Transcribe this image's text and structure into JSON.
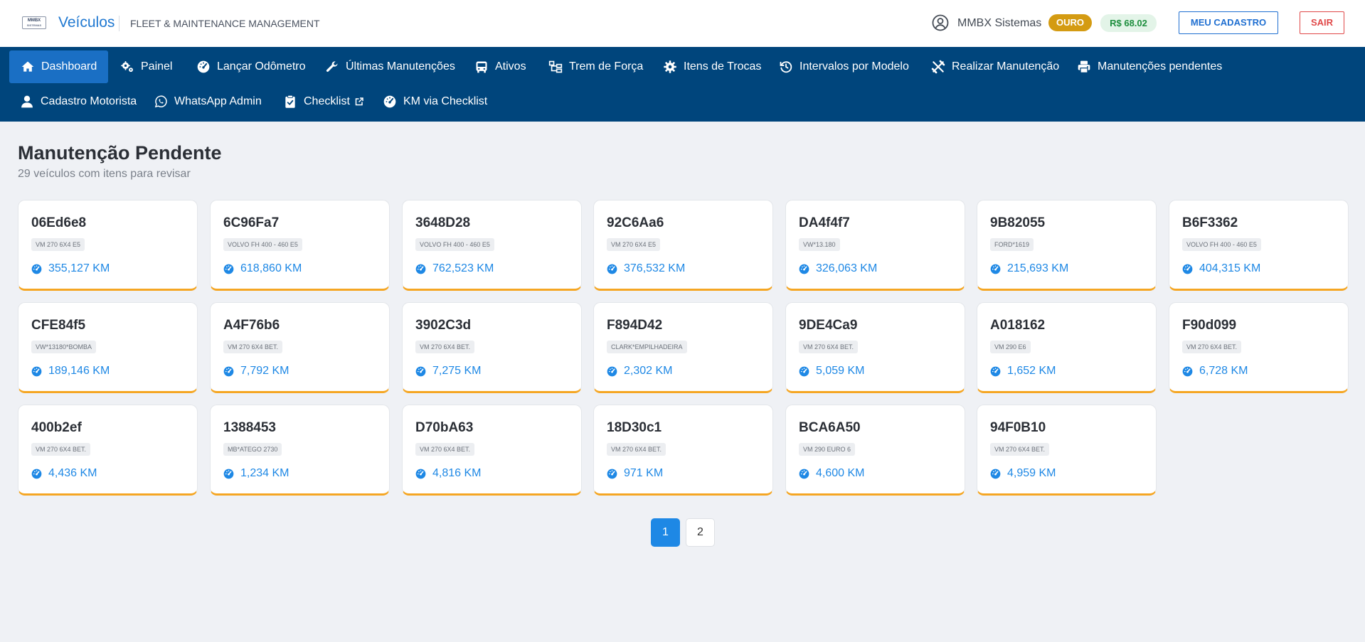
{
  "header": {
    "logo_text": "MMBX",
    "logo_subtext": "SISTEMAS",
    "app_title": "Veículos",
    "subtitle": "FLEET & MAINTENANCE MANAGEMENT",
    "company": "MMBX Sistemas",
    "plan_badge": "OURO",
    "credit": "R$ 68.02",
    "profile_button": "MEU CADASTRO",
    "logout_button": "SAIR"
  },
  "nav": {
    "items": [
      {
        "label": "Dashboard",
        "icon": "home-icon",
        "active": true
      },
      {
        "label": "Painel",
        "icon": "cogs-icon"
      },
      {
        "label": "Lançar Odômetro",
        "icon": "tachometer-icon"
      },
      {
        "label": "Últimas Manutenções",
        "icon": "wrench-icon"
      },
      {
        "label": "Ativos",
        "icon": "bus-icon"
      },
      {
        "label": "Trem de Força",
        "icon": "sitemap-icon"
      },
      {
        "label": "Itens de Trocas",
        "icon": "gear-icon"
      },
      {
        "label": "Intervalos por Modelo",
        "icon": "history-icon"
      },
      {
        "label": "Realizar Manutenção",
        "icon": "tools-icon"
      },
      {
        "label": "Manutenções pendentes",
        "icon": "print-icon"
      },
      {
        "label": "Cadastro Motorista",
        "icon": "user-icon"
      },
      {
        "label": "WhatsApp Admin",
        "icon": "whatsapp-icon"
      },
      {
        "label": "Checklist",
        "icon": "clipboard-check-icon",
        "external": true
      },
      {
        "label": "KM via Checklist",
        "icon": "tachometer-icon"
      }
    ]
  },
  "main": {
    "title": "Manutenção Pendente",
    "subtitle": "29 veículos com itens para revisar",
    "vehicles": [
      {
        "plate": "06Ed6e8",
        "model": "VM 270 6X4 E5",
        "km": "355,127 KM"
      },
      {
        "plate": "6C96Fa7",
        "model": "VOLVO FH 400 - 460 E5",
        "km": "618,860 KM"
      },
      {
        "plate": "3648D28",
        "model": "VOLVO FH 400 - 460 E5",
        "km": "762,523 KM"
      },
      {
        "plate": "92C6Aa6",
        "model": "VM 270 6X4 E5",
        "km": "376,532 KM"
      },
      {
        "plate": "DA4f4f7",
        "model": "VW*13.180",
        "km": "326,063 KM"
      },
      {
        "plate": "9B82055",
        "model": "FORD*1619",
        "km": "215,693 KM"
      },
      {
        "plate": "B6F3362",
        "model": "VOLVO FH 400 - 460 E5",
        "km": "404,315 KM"
      },
      {
        "plate": "CFE84f5",
        "model": "VW*13180*BOMBA",
        "km": "189,146 KM"
      },
      {
        "plate": "A4F76b6",
        "model": "VM 270 6X4 BET.",
        "km": "7,792 KM"
      },
      {
        "plate": "3902C3d",
        "model": "VM 270 6X4 BET.",
        "km": "7,275 KM"
      },
      {
        "plate": "F894D42",
        "model": "CLARK*EMPILHADEIRA",
        "km": "2,302 KM"
      },
      {
        "plate": "9DE4Ca9",
        "model": "VM 270 6X4 BET.",
        "km": "5,059 KM"
      },
      {
        "plate": "A018162",
        "model": "VM 290 E6",
        "km": "1,652 KM"
      },
      {
        "plate": "F90d099",
        "model": "VM 270 6X4 BET.",
        "km": "6,728 KM"
      },
      {
        "plate": "400b2ef",
        "model": "VM 270 6X4 BET.",
        "km": "4,436 KM"
      },
      {
        "plate": "1388453",
        "model": "MB*ATEGO 2730",
        "km": "1,234 KM"
      },
      {
        "plate": "D70bA63",
        "model": "VM 270 6X4 BET.",
        "km": "4,816 KM"
      },
      {
        "plate": "18D30c1",
        "model": "VM 270 6X4 BET.",
        "km": "971 KM"
      },
      {
        "plate": "BCA6A50",
        "model": "VM 290 EURO 6",
        "km": "4,600 KM"
      },
      {
        "plate": "94F0B10",
        "model": "VM 270 6X4 BET.",
        "km": "4,959 KM"
      }
    ]
  },
  "pagination": {
    "pages": [
      "1",
      "2"
    ],
    "current": "1"
  },
  "colors": {
    "nav_bg": "#00457c",
    "nav_active": "#1a6fc4",
    "accent_blue": "#1e88e5",
    "card_border_bottom": "#f5a623",
    "badge_gold": "#d49b12",
    "credit_green": "#1e8e3e",
    "logout_red": "#e04848"
  }
}
